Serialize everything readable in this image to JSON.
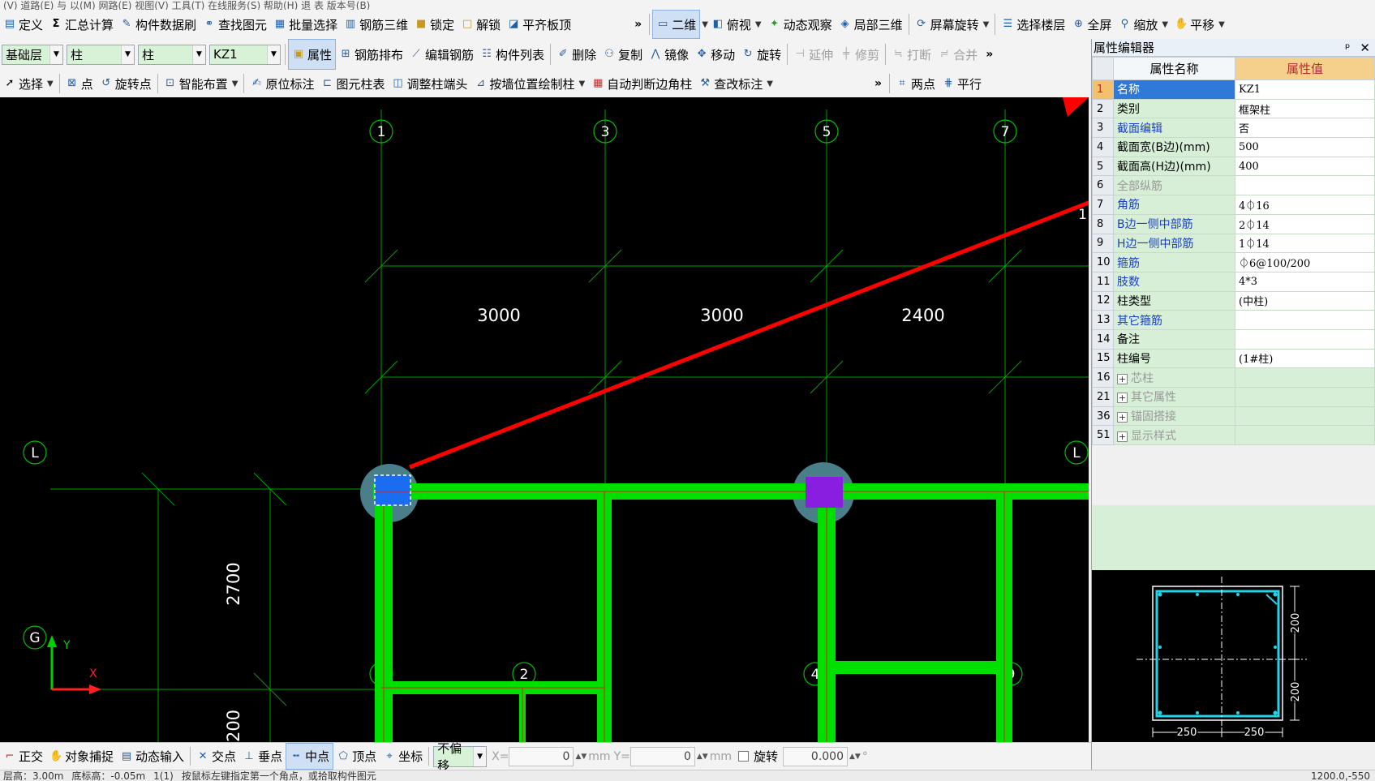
{
  "menubar": {
    "text": "(V) 道路(E) 与 以(M) 网路(E) 视图(V) 工具(T) 在线服务(S) 帮助(H) 退 表 版本号(B)"
  },
  "toolbar1": {
    "items": [
      {
        "label": "定义",
        "icon": "define-icon"
      },
      {
        "label": "汇总计算",
        "icon": "sigma-icon"
      },
      {
        "label": "构件数据刷",
        "icon": "brush-icon"
      },
      {
        "label": "查找图元",
        "icon": "binoculars-icon"
      },
      {
        "label": "批量选择",
        "icon": "batch-select-icon"
      },
      {
        "label": "钢筋三维",
        "icon": "rebar-3d-icon"
      },
      {
        "label": "锁定",
        "icon": "lock-icon"
      },
      {
        "label": "解锁",
        "icon": "unlock-icon"
      },
      {
        "label": "平齐板顶",
        "icon": "align-slab-icon"
      }
    ],
    "view_items": [
      {
        "label": "二维",
        "icon": "2d-icon"
      },
      {
        "label": "俯视",
        "icon": "top-view-icon"
      },
      {
        "label": "动态观察",
        "icon": "orbit-icon"
      },
      {
        "label": "局部三维",
        "icon": "local-3d-icon"
      },
      {
        "label": "屏幕旋转",
        "icon": "screen-rotate-icon"
      },
      {
        "label": "选择楼层",
        "icon": "floor-select-icon"
      },
      {
        "label": "全屏",
        "icon": "fullscreen-icon"
      },
      {
        "label": "缩放",
        "icon": "zoom-icon"
      },
      {
        "label": "平移",
        "icon": "pan-icon"
      }
    ]
  },
  "toolbar2": {
    "floor": "基础层",
    "type1": "柱",
    "type2": "柱",
    "component": "KZ1",
    "items": [
      {
        "label": "属性",
        "icon": "properties-icon"
      },
      {
        "label": "钢筋排布",
        "icon": "rebar-layout-icon"
      },
      {
        "label": "编辑钢筋",
        "icon": "edit-rebar-icon"
      },
      {
        "label": "构件列表",
        "icon": "component-list-icon"
      },
      {
        "label": "删除",
        "icon": "delete-icon"
      },
      {
        "label": "复制",
        "icon": "copy-icon"
      },
      {
        "label": "镜像",
        "icon": "mirror-icon"
      },
      {
        "label": "移动",
        "icon": "move-icon"
      },
      {
        "label": "旋转",
        "icon": "rotate-icon"
      },
      {
        "label": "延伸",
        "icon": "extend-icon"
      },
      {
        "label": "修剪",
        "icon": "trim-icon"
      },
      {
        "label": "打断",
        "icon": "break-icon"
      },
      {
        "label": "合并",
        "icon": "merge-icon"
      }
    ]
  },
  "toolbar3": {
    "items": [
      {
        "label": "选择",
        "icon": "cursor-icon"
      },
      {
        "label": "点",
        "icon": "point-icon"
      },
      {
        "label": "旋转点",
        "icon": "rotate-point-icon"
      },
      {
        "label": "智能布置",
        "icon": "smart-layout-icon"
      },
      {
        "label": "原位标注",
        "icon": "in-place-annotation-icon"
      },
      {
        "label": "图元柱表",
        "icon": "column-table-icon"
      },
      {
        "label": "调整柱端头",
        "icon": "adjust-column-end-icon"
      },
      {
        "label": "按墙位置绘制柱",
        "icon": "draw-by-wall-icon"
      },
      {
        "label": "自动判断边角柱",
        "icon": "auto-corner-column-icon"
      },
      {
        "label": "查改标注",
        "icon": "check-annotation-icon"
      },
      {
        "label": "两点",
        "icon": "two-point-icon"
      },
      {
        "label": "平行",
        "icon": "parallel-icon"
      }
    ]
  },
  "canvas": {
    "axes_top": [
      "1",
      "3",
      "5",
      "7"
    ],
    "axes_bottom": [
      "1",
      "2",
      "4",
      "9"
    ],
    "axes_left": [
      "L",
      "G"
    ],
    "axis_right": "L",
    "dims_horizontal": [
      "3000",
      "3000",
      "2400"
    ],
    "dims_vertical": [
      "2700",
      "200"
    ],
    "ucs_x": "X",
    "ucs_y": "Y",
    "edge_label": "1",
    "colors": {
      "beam": "#00e000",
      "grid": "#00a000",
      "column_selected": "#1a6cf0",
      "column": "#8a1ee0",
      "arrow": "#ff0000",
      "highlight": "#4a7f8a"
    }
  },
  "property_editor": {
    "title": "属性编辑器",
    "pin": "ᵖ",
    "close": "✕",
    "header_name": "属性名称",
    "header_value": "属性值",
    "rows": [
      {
        "num": "1",
        "name": "名称",
        "value": "KZ1",
        "style": "selected"
      },
      {
        "num": "2",
        "name": "类别",
        "value": "框架柱",
        "style": "normal"
      },
      {
        "num": "3",
        "name": "截面编辑",
        "value": "否",
        "style": "blue"
      },
      {
        "num": "4",
        "name": "截面宽(B边)(mm)",
        "value": "500",
        "style": "normal"
      },
      {
        "num": "5",
        "name": "截面高(H边)(mm)",
        "value": "400",
        "style": "normal"
      },
      {
        "num": "6",
        "name": "全部纵筋",
        "value": "",
        "style": "grey"
      },
      {
        "num": "7",
        "name": "角筋",
        "value": "4⏀16",
        "style": "blue"
      },
      {
        "num": "8",
        "name": "B边一侧中部筋",
        "value": "2⏀14",
        "style": "blue"
      },
      {
        "num": "9",
        "name": "H边一侧中部筋",
        "value": "1⏀14",
        "style": "blue"
      },
      {
        "num": "10",
        "name": "箍筋",
        "value": "⏀6@100/200",
        "style": "blue"
      },
      {
        "num": "11",
        "name": "肢数",
        "value": "4*3",
        "style": "blue"
      },
      {
        "num": "12",
        "name": "柱类型",
        "value": "(中柱)",
        "style": "normal"
      },
      {
        "num": "13",
        "name": "其它箍筋",
        "value": "",
        "style": "blue"
      },
      {
        "num": "14",
        "name": "备注",
        "value": "",
        "style": "normal"
      },
      {
        "num": "15",
        "name": "柱编号",
        "value": "(1#柱)",
        "style": "normal"
      },
      {
        "num": "16",
        "name": "芯柱",
        "value": "",
        "style": "group"
      },
      {
        "num": "21",
        "name": "其它属性",
        "value": "",
        "style": "group"
      },
      {
        "num": "36",
        "name": "锚固搭接",
        "value": "",
        "style": "group"
      },
      {
        "num": "51",
        "name": "显示样式",
        "value": "",
        "style": "group"
      }
    ]
  },
  "section_preview": {
    "dim_h1": "250",
    "dim_h2": "250",
    "dim_v1": "200",
    "dim_v2": "200"
  },
  "statusbar": {
    "items": [
      {
        "label": "正交",
        "icon": "ortho-icon"
      },
      {
        "label": "对象捕捉",
        "icon": "object-snap-icon"
      },
      {
        "label": "动态输入",
        "icon": "dynamic-input-icon"
      },
      {
        "label": "交点",
        "icon": "intersection-icon"
      },
      {
        "label": "垂点",
        "icon": "perpendicular-icon"
      },
      {
        "label": "中点",
        "icon": "midpoint-icon"
      },
      {
        "label": "顶点",
        "icon": "vertex-icon"
      },
      {
        "label": "坐标",
        "icon": "coordinate-icon"
      }
    ],
    "offset_mode": "不偏移",
    "x_label": "X=",
    "x_value": "0",
    "unit1": "mm",
    "y_label": "Y=",
    "y_value": "0",
    "unit2": "mm",
    "rotate_label": "旋转",
    "rotate_value": "0.000",
    "degree": "°"
  },
  "bottombar": {
    "text1": "层高：3.00m",
    "text2": "底标高：-0.05m",
    "text3": "1(1)",
    "hint": "按鼠标左键指定第一个角点，或拾取构件图元",
    "coords": "1200.0,-550"
  }
}
